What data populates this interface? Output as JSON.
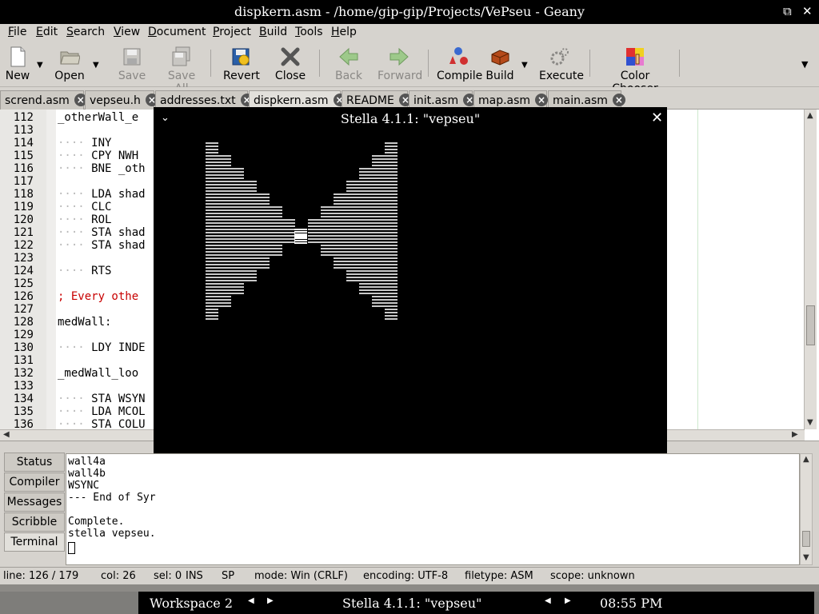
{
  "window": {
    "title": "dispkern.asm - /home/gip-gip/Projects/VePseu - Geany"
  },
  "menu": [
    {
      "label": "File",
      "u": "F",
      "rest": "ile"
    },
    {
      "label": "Edit",
      "u": "E",
      "rest": "dit"
    },
    {
      "label": "Search",
      "u": "S",
      "rest": "earch"
    },
    {
      "label": "View",
      "u": "V",
      "rest": "iew"
    },
    {
      "label": "Document",
      "u": "D",
      "rest": "ocument"
    },
    {
      "label": "Project",
      "u": "P",
      "rest": "roject"
    },
    {
      "label": "Build",
      "u": "B",
      "rest": "uild"
    },
    {
      "label": "Tools",
      "u": "T",
      "rest": "ools"
    },
    {
      "label": "Help",
      "u": "H",
      "rest": "elp"
    }
  ],
  "toolbar": {
    "new": "New",
    "open": "Open",
    "save": "Save",
    "save_all": "Save All",
    "revert": "Revert",
    "close": "Close",
    "back": "Back",
    "forward": "Forward",
    "compile": "Compile",
    "build": "Build",
    "execute": "Execute",
    "color_chooser": "Color Chooser"
  },
  "tabs": [
    "scrend.asm",
    "vepseu.h",
    "addresses.txt",
    "dispkern.asm",
    "README",
    "init.asm",
    "map.asm",
    "main.asm"
  ],
  "active_tab": "dispkern.asm",
  "editor": {
    "lines": [
      {
        "n": "112",
        "t": "_otherWall_e",
        "i": 0
      },
      {
        "n": "113",
        "t": "",
        "i": 0
      },
      {
        "n": "114",
        "t": "INY",
        "i": 1
      },
      {
        "n": "115",
        "t": "CPY NWH",
        "i": 1
      },
      {
        "n": "116",
        "t": "BNE _oth",
        "i": 1
      },
      {
        "n": "117",
        "t": "",
        "i": 0
      },
      {
        "n": "118",
        "t": "LDA shad",
        "i": 1
      },
      {
        "n": "119",
        "t": "CLC",
        "i": 1
      },
      {
        "n": "120",
        "t": "ROL",
        "i": 1
      },
      {
        "n": "121",
        "t": "STA shad",
        "i": 1
      },
      {
        "n": "122",
        "t": "STA shad",
        "i": 1
      },
      {
        "n": "123",
        "t": "",
        "i": 0
      },
      {
        "n": "124",
        "t": "RTS",
        "i": 1
      },
      {
        "n": "125",
        "t": "",
        "i": 0
      },
      {
        "n": "126",
        "t": "; Every othe",
        "i": 0,
        "comment": true
      },
      {
        "n": "127",
        "t": "",
        "i": 0
      },
      {
        "n": "128",
        "t": "medWall:",
        "i": 0
      },
      {
        "n": "129",
        "t": "",
        "i": 0
      },
      {
        "n": "130",
        "t": "LDY INDE",
        "i": 1
      },
      {
        "n": "131",
        "t": "",
        "i": 0
      },
      {
        "n": "132",
        "t": "_medWall_loo",
        "i": 0
      },
      {
        "n": "133",
        "t": "",
        "i": 0
      },
      {
        "n": "134",
        "t": "STA WSYN",
        "i": 1
      },
      {
        "n": "135",
        "t": "LDA MCOL",
        "i": 1
      },
      {
        "n": "136",
        "t": "STA COLU",
        "i": 1
      }
    ]
  },
  "panel": {
    "tabs": [
      "Status",
      "Compiler",
      "Messages",
      "Scribble",
      "Terminal"
    ],
    "active": "Terminal",
    "terminal_lines": [
      "wall4a",
      "wall4b",
      "WSYNC",
      "--- End of Syr",
      "",
      "Complete.",
      "stella vepseu."
    ]
  },
  "statusbar": {
    "line": "line: 126 / 179",
    "col": "col: 26",
    "sel": "sel: 0",
    "ins": "INS",
    "sp": "SP",
    "mode": "mode: Win (CRLF)",
    "encoding": "encoding: UTF-8",
    "filetype": "filetype: ASM",
    "scope": "scope: unknown"
  },
  "taskbar": {
    "workspace": "Workspace 2",
    "window": "Stella 4.1.1: \"vepseu\"",
    "clock": "08:55 PM"
  },
  "stella": {
    "title": "Stella 4.1.1: \"vepseu\"",
    "wall": {
      "left_rows": [
        1,
        1,
        2,
        2,
        3,
        3,
        4,
        4,
        5,
        5,
        6,
        6,
        7,
        7,
        7,
        7,
        6,
        6,
        5,
        5,
        4,
        4,
        3,
        3,
        2,
        2,
        1,
        1
      ],
      "right_rows": [
        1,
        1,
        2,
        2,
        3,
        3,
        4,
        4,
        5,
        5,
        6,
        6,
        7,
        7,
        7,
        7,
        6,
        6,
        5,
        5,
        4,
        4,
        3,
        3,
        2,
        2,
        1,
        1
      ],
      "center_rows": [
        14,
        15
      ]
    }
  },
  "colors": {
    "wall": "#c8c8c8",
    "comment": "#c80000",
    "chrome": "#d6d3ce"
  }
}
